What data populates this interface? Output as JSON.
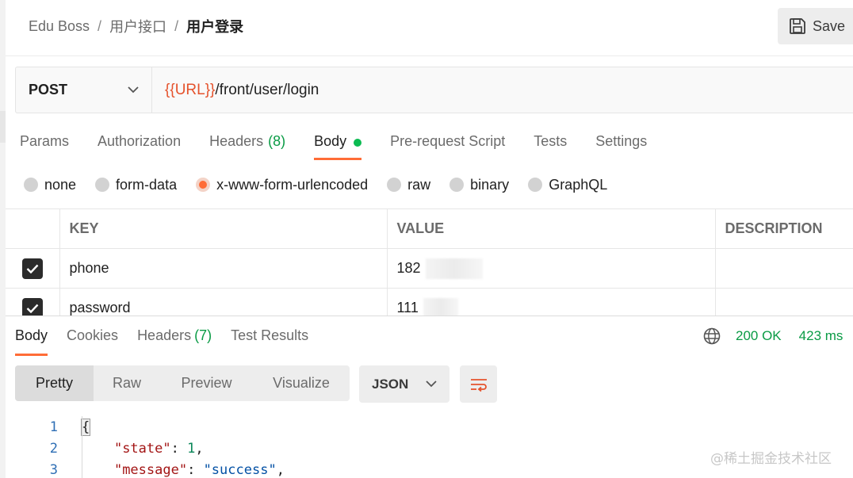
{
  "breadcrumb": {
    "workspace": "Edu Boss",
    "folder": "用户接口",
    "request": "用户登录",
    "separator": "/"
  },
  "toolbar": {
    "save_label": "Save"
  },
  "request": {
    "method": "POST",
    "url_variable": "{{URL}}",
    "url_path": "/front/user/login"
  },
  "request_tabs": [
    {
      "label": "Params",
      "count": ""
    },
    {
      "label": "Authorization",
      "count": ""
    },
    {
      "label": "Headers",
      "count": "(8)"
    },
    {
      "label": "Body",
      "count": ""
    },
    {
      "label": "Pre-request Script",
      "count": ""
    },
    {
      "label": "Tests",
      "count": ""
    },
    {
      "label": "Settings",
      "count": ""
    }
  ],
  "body_types": [
    "none",
    "form-data",
    "x-www-form-urlencoded",
    "raw",
    "binary",
    "GraphQL"
  ],
  "selected_body_type": "x-www-form-urlencoded",
  "params_table": {
    "headers": [
      "KEY",
      "VALUE",
      "DESCRIPTION"
    ],
    "rows": [
      {
        "key": "phone",
        "value": "182",
        "description": "",
        "checked": true
      },
      {
        "key": "password",
        "value": "111",
        "description": "",
        "checked": true
      }
    ]
  },
  "response": {
    "tabs": [
      {
        "label": "Body",
        "count": ""
      },
      {
        "label": "Cookies",
        "count": ""
      },
      {
        "label": "Headers",
        "count": "(7)"
      },
      {
        "label": "Test Results",
        "count": ""
      }
    ],
    "status": "200 OK",
    "time": "423 ms",
    "view_tabs": [
      "Pretty",
      "Raw",
      "Preview",
      "Visualize"
    ],
    "format": "JSON",
    "code_lines": [
      {
        "no": "1",
        "text": "{"
      },
      {
        "no": "2",
        "key": "\"state\"",
        "value": "1",
        "suffix": ","
      },
      {
        "no": "3",
        "key": "\"message\"",
        "value": "\"success\"",
        "suffix": ","
      }
    ]
  },
  "watermark": "@稀土掘金技术社区",
  "colors": {
    "accent": "#ff6c37",
    "success": "#0a9b45",
    "variable": "#e5532d"
  },
  "icons": [
    "save-icon",
    "chevron-down-icon",
    "checkbox-checked-icon",
    "globe-icon",
    "wrap-lines-icon"
  ]
}
